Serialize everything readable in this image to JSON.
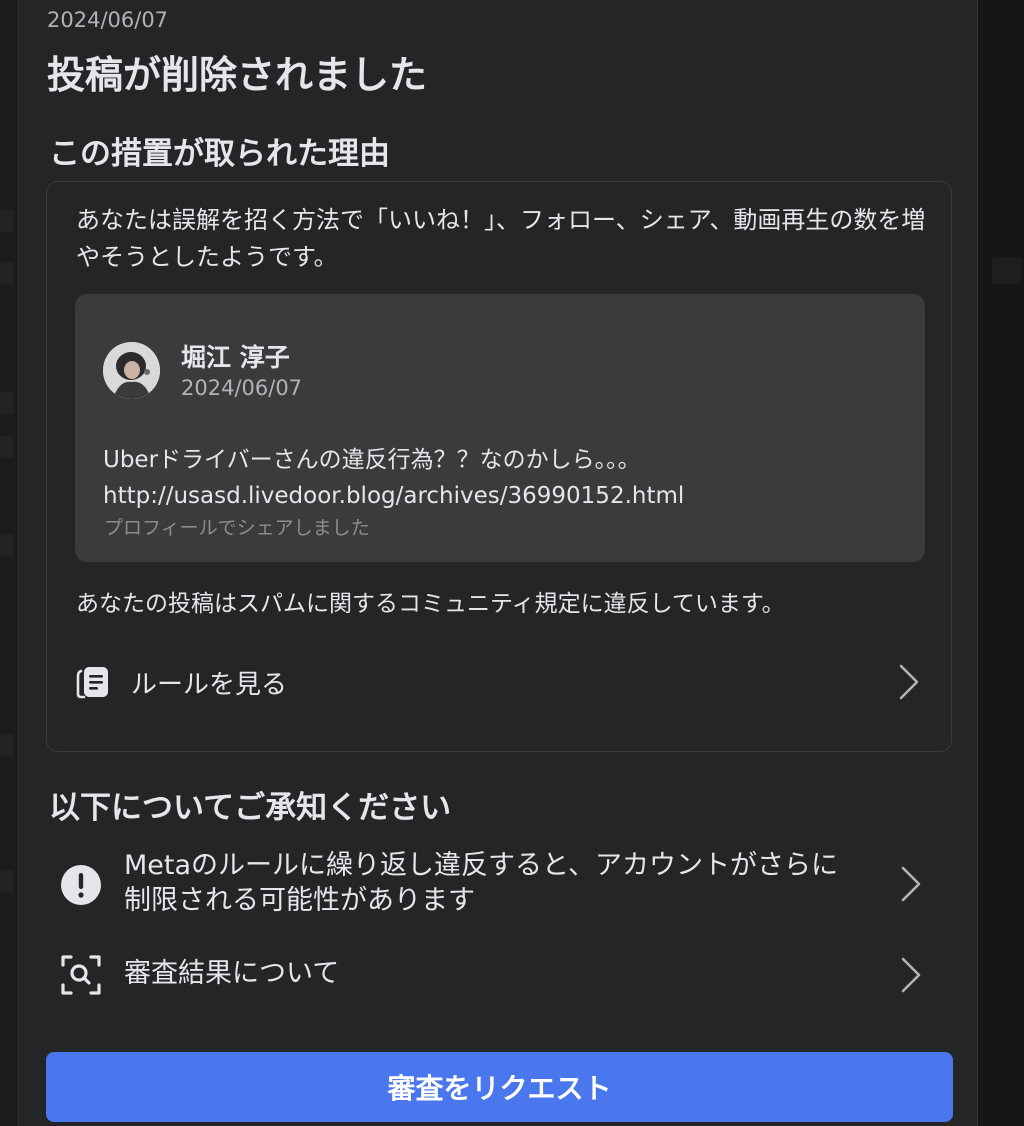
{
  "header": {
    "date": "2024/06/07",
    "title": "投稿が削除されました"
  },
  "reason": {
    "heading": "この措置が取られた理由",
    "text": "あなたは誤解を招く方法で「いいね！」、フォロー、シェア、動画再生の数を増やそうとしたようです。",
    "post": {
      "author": "堀江 淳子",
      "date": "2024/06/07",
      "body_line1": "Uberドライバーさんの違反行為？？なのかしら。。。",
      "body_line2": "http://usasd.livedoor.blog/archives/36990152.html",
      "share_note": "プロフィールでシェアしました"
    },
    "violation_text": "あなたの投稿はスパムに関するコミュニティ規定に違反しています。",
    "rules_link": {
      "label": "ルールを見る",
      "icon": "document-icon"
    }
  },
  "notice": {
    "heading": "以下についてご承知ください",
    "items": [
      {
        "label": "Metaのルールに繰り返し違反すると、アカウントがさらに制限される可能性があります",
        "icon": "alert-icon"
      },
      {
        "label": "審査結果について",
        "icon": "review-search-icon"
      }
    ]
  },
  "cta": {
    "label": "審査をリクエスト"
  },
  "colors": {
    "panel_bg": "#242526",
    "card_bg": "#3a3b3c",
    "accent": "#4a76ee",
    "text_primary": "#e4e6eb",
    "text_secondary": "#b0b3b8"
  }
}
